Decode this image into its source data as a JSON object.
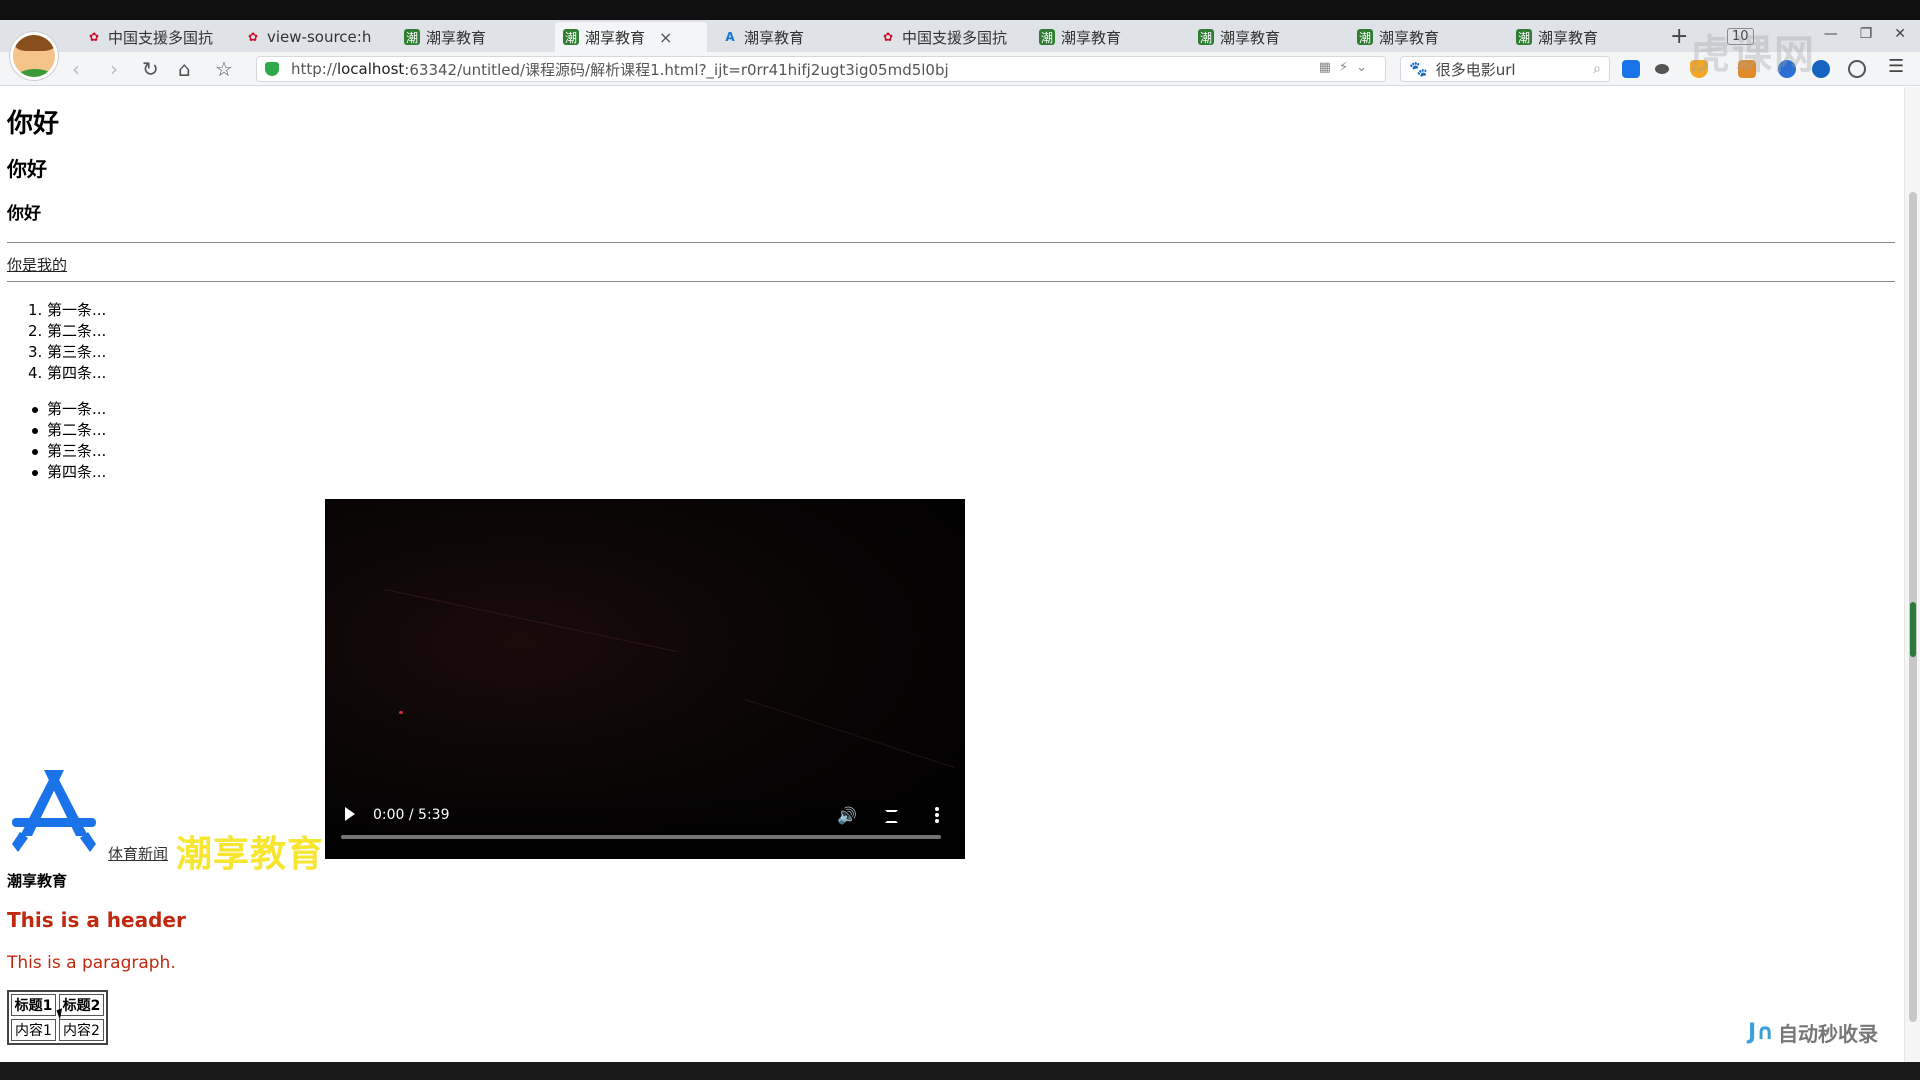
{
  "tabs": [
    {
      "label": "中国支援多国抗",
      "icon": "huawei-favicon-icon"
    },
    {
      "label": "view-source:h",
      "icon": "huawei-favicon-icon"
    },
    {
      "label": "潮享教育",
      "icon": "site-favicon-icon"
    },
    {
      "label": "潮享教育",
      "icon": "site-favicon-icon",
      "active": true
    },
    {
      "label": "潮享教育",
      "icon": "appstore-favicon-icon"
    },
    {
      "label": "中国支援多国抗",
      "icon": "huawei-favicon-icon"
    },
    {
      "label": "潮享教育",
      "icon": "site-favicon-icon"
    },
    {
      "label": "潮享教育",
      "icon": "site-favicon-icon"
    },
    {
      "label": "潮享教育",
      "icon": "site-favicon-icon"
    },
    {
      "label": "潮享教育",
      "icon": "site-favicon-icon"
    }
  ],
  "tab_count": "10",
  "address": {
    "protocol": "http://",
    "host": "localhost",
    "rest": ":63342/untitled/课程源码/解析课程1.html?_ijt=r0rr41hifj2ugt3ig05md5l0bj"
  },
  "search": {
    "value": "很多电影url"
  },
  "page": {
    "h1": "你好",
    "h2": "你好",
    "h3": "你好",
    "link": "你是我的",
    "ordered_list": [
      {
        "num": "1.",
        "text": "第一条..."
      },
      {
        "num": "2.",
        "text": "第二条..."
      },
      {
        "num": "3.",
        "text": "第三条..."
      },
      {
        "num": "4.",
        "text": "第四条..."
      }
    ],
    "unordered_list": [
      "第一条...",
      "第二条...",
      "第三条...",
      "第四条..."
    ],
    "sports_link": "体育新闻",
    "brand_text": "潮享教育",
    "video": {
      "time": "0:00 / 5:39",
      "progress": 0.0
    },
    "bold_line": "潮享教育",
    "red_header": "This is a header",
    "red_paragraph": "This is a paragraph.",
    "table": {
      "headers": [
        "标题1",
        "标题2"
      ],
      "rows": [
        [
          "内容1",
          "内容2"
        ]
      ]
    }
  },
  "watermark_top": "虎课网",
  "watermark_bottom": "自动秒收录",
  "colors": {
    "red_text": "#c0290f",
    "brand_yellow": "#f7e52f",
    "link_color": "#222222",
    "app_icon_blue": "#1a73e8"
  }
}
